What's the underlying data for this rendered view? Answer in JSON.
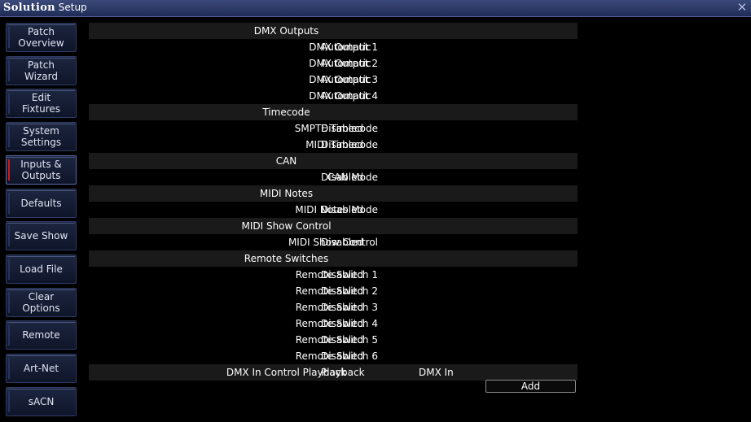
{
  "window": {
    "title_brand": "Solution",
    "title_rest": " Setup",
    "close_glyph": "✕"
  },
  "colors": {
    "titlebar": "#2b3868",
    "active_marker": "#d01818",
    "header_row": "#1a1a1a"
  },
  "sidebar": {
    "items": [
      {
        "label": "Patch\nOverview",
        "active": false
      },
      {
        "label": "Patch\nWizard",
        "active": false
      },
      {
        "label": "Edit\nFixtures",
        "active": false
      },
      {
        "label": "System\nSettings",
        "active": false
      },
      {
        "label": "Inputs &\nOutputs",
        "active": true
      },
      {
        "label": "Defaults",
        "active": false
      },
      {
        "label": "Save Show",
        "active": false
      },
      {
        "label": "Load File",
        "active": false
      },
      {
        "label": "Clear\nOptions",
        "active": false
      },
      {
        "label": "Remote",
        "active": false
      },
      {
        "label": "Art-Net",
        "active": false
      },
      {
        "label": "sACN",
        "active": false
      }
    ]
  },
  "rows": [
    {
      "type": "header",
      "label": "DMX Outputs"
    },
    {
      "type": "item",
      "label": "DMX Output 1",
      "value": "Automatic"
    },
    {
      "type": "item",
      "label": "DMX Output 2",
      "value": "Automatic"
    },
    {
      "type": "item",
      "label": "DMX Output 3",
      "value": "Automatic"
    },
    {
      "type": "item",
      "label": "DMX Output 4",
      "value": "Automatic"
    },
    {
      "type": "header",
      "label": "Timecode"
    },
    {
      "type": "item",
      "label": "SMPTE Timecode",
      "value": "Disabled"
    },
    {
      "type": "item",
      "label": "MIDI Timecode",
      "value": "Disabled"
    },
    {
      "type": "header",
      "label": "CAN"
    },
    {
      "type": "item",
      "label": "CAN Mode",
      "value": "Disabled"
    },
    {
      "type": "header",
      "label": "MIDI Notes"
    },
    {
      "type": "item",
      "label": "MIDI Notes Mode",
      "value": "Disabled"
    },
    {
      "type": "header",
      "label": "MIDI Show Control"
    },
    {
      "type": "item",
      "label": "MIDI Show Control",
      "value": "Disabled"
    },
    {
      "type": "header",
      "label": "Remote Switches"
    },
    {
      "type": "item",
      "label": "Remote Switch 1",
      "value": "Disabled"
    },
    {
      "type": "item",
      "label": "Remote Switch 2",
      "value": "Disabled"
    },
    {
      "type": "item",
      "label": "Remote Switch 3",
      "value": "Disabled"
    },
    {
      "type": "item",
      "label": "Remote Switch 4",
      "value": "Disabled"
    },
    {
      "type": "item",
      "label": "Remote Switch 5",
      "value": "Disabled"
    },
    {
      "type": "item",
      "label": "Remote Switch 6",
      "value": "Disabled"
    },
    {
      "type": "dmxin",
      "label": "DMX In Control Playback",
      "value": "Playback",
      "extra": "DMX In"
    }
  ],
  "add_button": {
    "label": "Add"
  }
}
